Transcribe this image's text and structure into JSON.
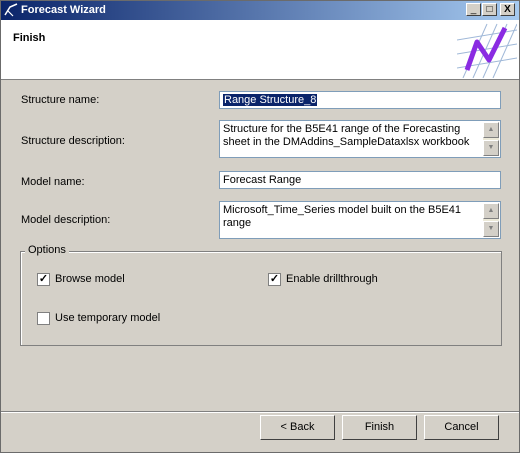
{
  "window": {
    "title": "Forecast Wizard"
  },
  "title_buttons": {
    "minimize": "_",
    "maximize": "□",
    "close": "X"
  },
  "header": {
    "heading": "Finish"
  },
  "form": {
    "structure_name_label": "Structure name:",
    "structure_name_value": "Range Structure_8",
    "structure_description_label": "Structure description:",
    "structure_description_value": "Structure for the B5E41 range of the Forecasting sheet in the DMAddins_SampleDataxlsx workbook",
    "model_name_label": "Model name:",
    "model_name_value": "Forecast Range",
    "model_description_label": "Model description:",
    "model_description_value": "Microsoft_Time_Series model built on the B5E41 range"
  },
  "options": {
    "legend": "Options",
    "browse_model": {
      "label": "Browse model",
      "checked": true
    },
    "enable_drillthrough": {
      "label": "Enable drillthrough",
      "checked": true
    },
    "use_temporary_model": {
      "label": "Use temporary model",
      "checked": false
    }
  },
  "buttons": {
    "back": "< Back",
    "finish": "Finish",
    "cancel": "Cancel"
  },
  "colors": {
    "title_bar_start": "#0a246a",
    "title_bar_end": "#a6caf0",
    "selection": "#0a246a",
    "dialog": "#d4d0c8"
  }
}
